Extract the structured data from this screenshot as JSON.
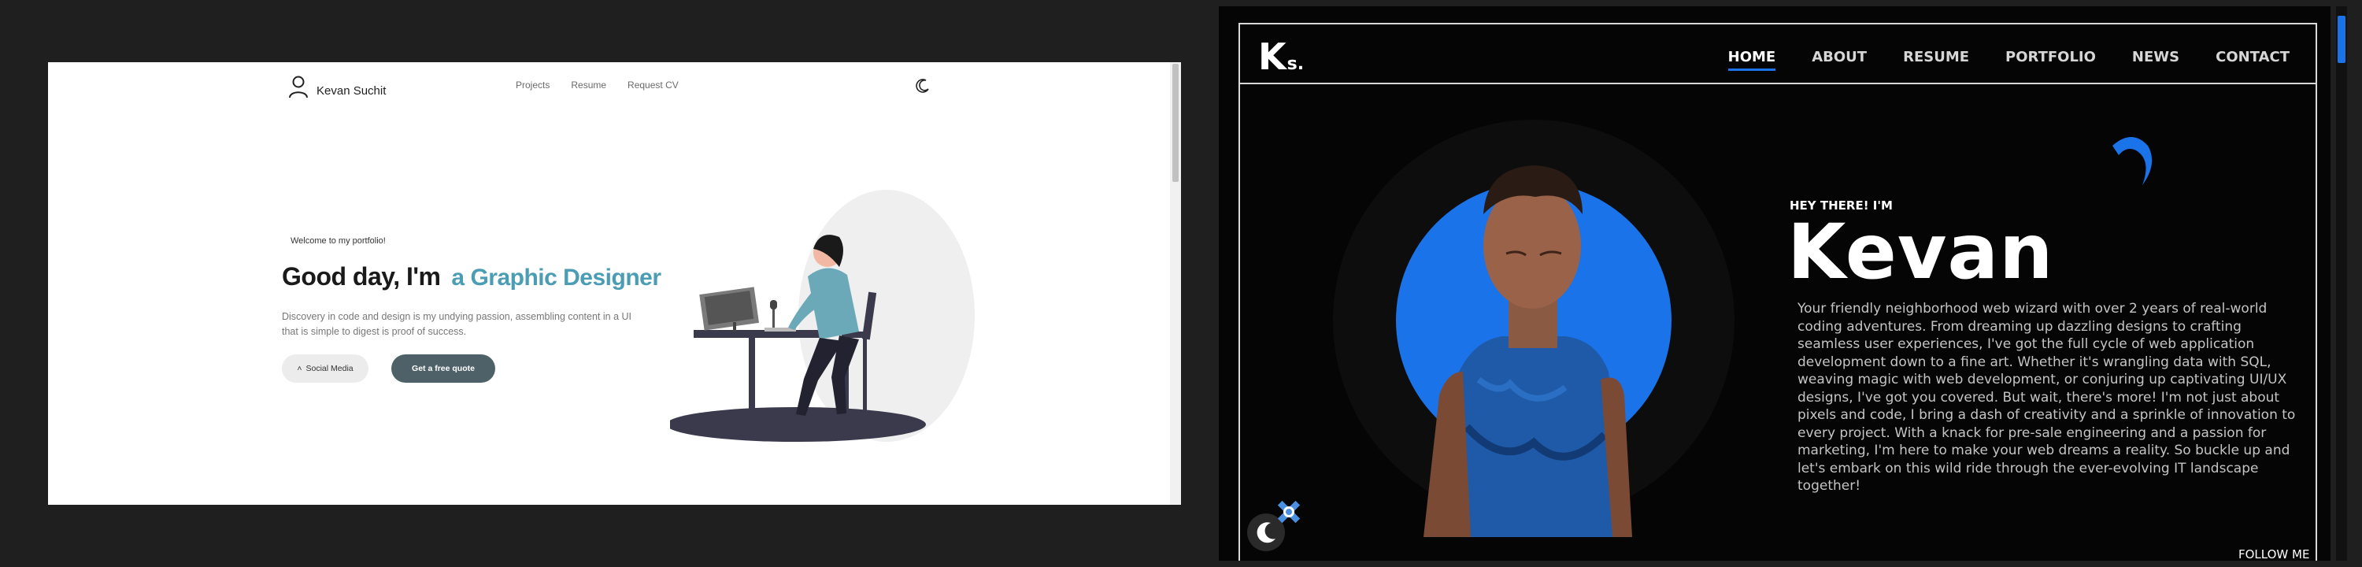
{
  "left_site": {
    "brand": "Kevan Suchit",
    "nav": [
      "Projects",
      "Resume",
      "Request CV"
    ],
    "hero": {
      "tagline": "Welcome to my portfolio!",
      "greeting": "Good day, I'm",
      "role": "a Graphic Designer",
      "description": "Discovery in code and design is my undying passion, assembling content in a UI that is simple to digest is proof of success.",
      "social_button": "Social Media",
      "quote_button": "Get a free quote"
    }
  },
  "right_site": {
    "logo_main": "K",
    "logo_sub": "s.",
    "nav": [
      "HOME",
      "ABOUT",
      "RESUME",
      "PORTFOLIO",
      "NEWS",
      "CONTACT"
    ],
    "active_nav": "HOME",
    "greeting": "HEY THERE! I'M",
    "name": "Kevan",
    "bio": "Your friendly neighborhood web wizard with over 2 years of real-world coding adventures. From dreaming up dazzling designs to crafting seamless user experiences, I've got the full cycle of web application development down to a fine art. Whether it's wrangling data with SQL, weaving magic with web development, or conjuring up captivating UI/UX designs, I've got you covered. But wait, there's more! I'm not just about pixels and code, I bring a dash of creativity and a sprinkle of innovation to every project. With a knack for pre-sale engineering and a passion for marketing, I'm here to make your web dreams a reality. So buckle up and let's embark on this wild ride through the ever-evolving IT landscape together!",
    "follow": "FOLLOW ME"
  },
  "colors": {
    "accent_blue": "#1a73e8",
    "teal": "#4a9db3",
    "dark_button": "#4f6168"
  }
}
